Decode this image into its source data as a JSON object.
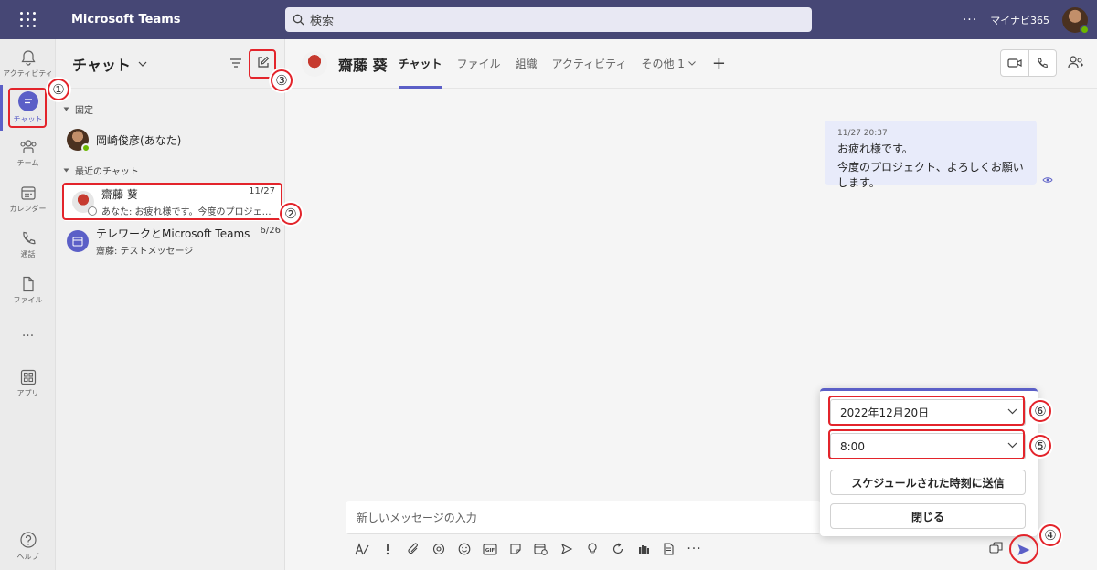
{
  "app": {
    "title": "Microsoft Teams",
    "user_name": "マイナビ365"
  },
  "search": {
    "placeholder": "検索"
  },
  "rail": {
    "items": [
      {
        "label": "アクティビティ",
        "icon": "bell-icon"
      },
      {
        "label": "チャット",
        "icon": "chat-icon",
        "active": true
      },
      {
        "label": "チーム",
        "icon": "teams-icon"
      },
      {
        "label": "カレンダー",
        "icon": "calendar-icon"
      },
      {
        "label": "通話",
        "icon": "phone-icon"
      },
      {
        "label": "ファイル",
        "icon": "file-icon"
      },
      {
        "label": "アプリ",
        "icon": "apps-icon"
      },
      {
        "label": "ヘルプ",
        "icon": "help-icon"
      }
    ]
  },
  "chat_list": {
    "title": "チャット",
    "pinned_label": "固定",
    "recent_label": "最近のチャット",
    "pinned": [
      {
        "name": "岡崎俊彦(あなた)"
      }
    ],
    "recent": [
      {
        "name": "齋藤 葵",
        "date": "11/27",
        "preview": "あなた: お疲れ様です。今度のプロジェクト、よろしくお願いします。"
      },
      {
        "name": "テレワークとMicrosoft Teams",
        "date": "6/26",
        "preview": "齋藤: テストメッセージ"
      }
    ]
  },
  "chat": {
    "name": "齋藤 葵",
    "tabs": [
      "チャット",
      "ファイル",
      "組織",
      "アクティビティ",
      "その他 1"
    ],
    "message": {
      "time": "11/27 20:37",
      "lines": [
        "お疲れ様です。",
        "今度のプロジェクト、よろしくお願いします。"
      ]
    },
    "composer_placeholder": "新しいメッセージの入力"
  },
  "schedule_popup": {
    "date": "2022年12月20日",
    "time": "8:00",
    "send_label": "スケジュールされた時刻に送信",
    "close_label": "閉じる"
  },
  "annotations": [
    "①",
    "②",
    "③",
    "④",
    "⑤",
    "⑥"
  ],
  "colors": {
    "topbar": "#464775",
    "accent": "#5b5fc7",
    "highlight": "#e3242b",
    "presence": "#6bb700"
  }
}
